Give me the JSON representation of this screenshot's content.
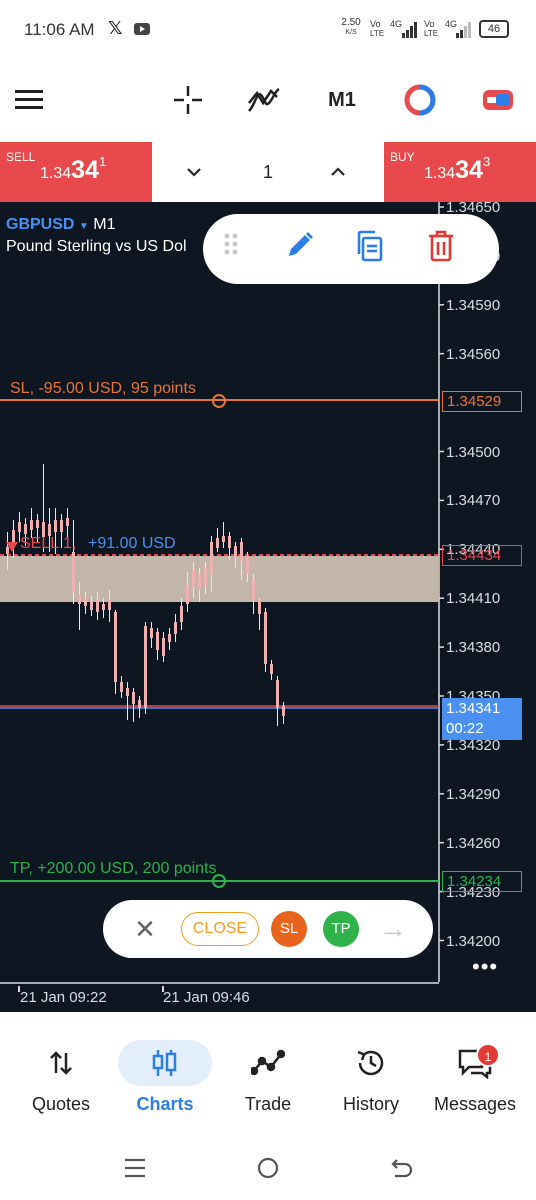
{
  "status_bar": {
    "time": "11:06 AM",
    "x_icon": "x-logo-icon",
    "yt_icon": "youtube-icon",
    "net_speed": "2.50",
    "net_unit": "K/S",
    "sim1_label": "Vo",
    "sim1_sub": "LTE",
    "sim1_net": "4G",
    "sim2_label": "Vo",
    "sim2_sub": "LTE",
    "sim2_net": "4G",
    "battery": "46"
  },
  "toolbar": {
    "menu_icon": "hamburger-icon",
    "crosshair_icon": "crosshair-icon",
    "indicators_icon": "indicators-icon",
    "timeframe": "M1",
    "chart_type_icon": "chart-type-icon",
    "trade_icon": "trade-toggle-icon"
  },
  "trade_bar": {
    "sell_label": "SELL",
    "sell_price_prefix": "1.34",
    "sell_price_big": "34",
    "sell_price_sup": "1",
    "buy_label": "BUY",
    "buy_price_prefix": "1.34",
    "buy_price_big": "34",
    "buy_price_sup": "3",
    "lot": "1"
  },
  "chart": {
    "symbol": "GBPUSD",
    "timeframe": "M1",
    "description": "Pound Sterling vs US Dol",
    "y_ticks": [
      "1.34650",
      "1.34620",
      "1.34590",
      "1.34560",
      "1.34500",
      "1.34470",
      "1.34440",
      "1.34410",
      "1.34380",
      "1.34350",
      "1.34320",
      "1.34290",
      "1.34260",
      "1.34230",
      "1.34200"
    ],
    "sl_label": "SL, -95.00 USD, 95 points",
    "sl_price": "1.34529",
    "sell_line_label": "SELL 1,",
    "sell_line_pnl": "+91.00 USD",
    "sell_line_price": "1.34434",
    "current_price": "1.34341",
    "current_countdown": "00:22",
    "tp_label": "TP, +200.00 USD, 200 points",
    "tp_price": "1.34234",
    "x_ticks": [
      "21 Jan 09:22",
      "21 Jan 09:46"
    ],
    "colors": {
      "background": "#0e1621",
      "sl": "#e8743a",
      "sell": "#e8494c",
      "tp": "#2fb24a",
      "current": "#4a90f0",
      "band": "#c2b6aa"
    }
  },
  "edit_popup": {
    "drag_icon": "drag-handle-icon",
    "edit_icon": "pencil-icon",
    "copy_icon": "copy-icon",
    "delete_icon": "trash-icon"
  },
  "action_pill": {
    "close_x": "✕",
    "close_label": "CLOSE",
    "sl_label": "SL",
    "tp_label": "TP",
    "arrow": "→"
  },
  "more_menu": "•••",
  "bottom_nav": {
    "items": [
      {
        "label": "Quotes",
        "icon": "quotes-icon"
      },
      {
        "label": "Charts",
        "icon": "charts-icon"
      },
      {
        "label": "Trade",
        "icon": "trade-icon"
      },
      {
        "label": "History",
        "icon": "history-icon"
      },
      {
        "label": "Messages",
        "icon": "messages-icon"
      }
    ],
    "active": "Charts",
    "messages_badge": "1"
  },
  "system_nav": {
    "recents_icon": "recents-icon",
    "home_icon": "home-icon",
    "back_icon": "back-icon"
  }
}
